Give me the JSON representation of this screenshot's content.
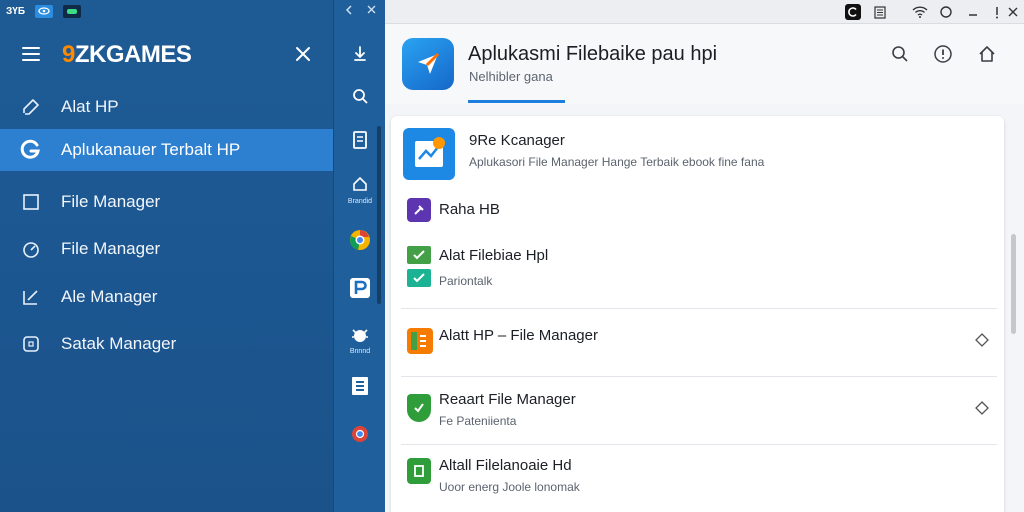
{
  "drawer": {
    "top_chip": "ЗҮБ",
    "brand_prefix": "9",
    "brand_rest": "ZKGAMES",
    "items": [
      {
        "label": "Alat HP",
        "icon": "edit-pencil-icon"
      },
      {
        "label": "Aplukanauer Terbalt HP",
        "icon": "g-logo-icon",
        "active": true
      },
      {
        "label": "File Manager",
        "icon": "square-icon"
      },
      {
        "label": "File Manager",
        "icon": "gauge-icon"
      },
      {
        "label": "Ale Manager",
        "icon": "edit-box-icon"
      },
      {
        "label": "Satak Manager",
        "icon": "rounded-square-icon"
      }
    ]
  },
  "rail": {
    "caption_1": "Brandid",
    "caption_2": "Bnnnd"
  },
  "app": {
    "title": "Aplukasmi Filebaike pau hpi",
    "subtitle": "Nelhibler gana",
    "rows": [
      {
        "title": "9Re Kcanager",
        "sub": "Aplukasori File Manager Hange Terbaik ebook fine fana",
        "icon": "file-manager-icon",
        "color": "#1e88e5"
      },
      {
        "title": "Raha HB",
        "sub": "",
        "icon": "purple-tool-icon",
        "color": "#5e35b1"
      },
      {
        "title": "Alat Filebiae Hpl",
        "sub": "Pariontalk",
        "icon": "check-badge-icon",
        "color": "#43a047"
      },
      {
        "title": "Alatt HP – File Manager",
        "sub": "",
        "icon": "orange-grid-icon",
        "color": "#f57c00"
      },
      {
        "title": "Reaart File Manager",
        "sub": "Fe Pateniienta",
        "icon": "green-shield-icon",
        "color": "#2e9d3a"
      },
      {
        "title": "Altall Filelanoaie Hd",
        "sub": "Uoor energ Joole lonomak",
        "icon": "green-square-icon",
        "color": "#2e9d3a"
      }
    ]
  }
}
